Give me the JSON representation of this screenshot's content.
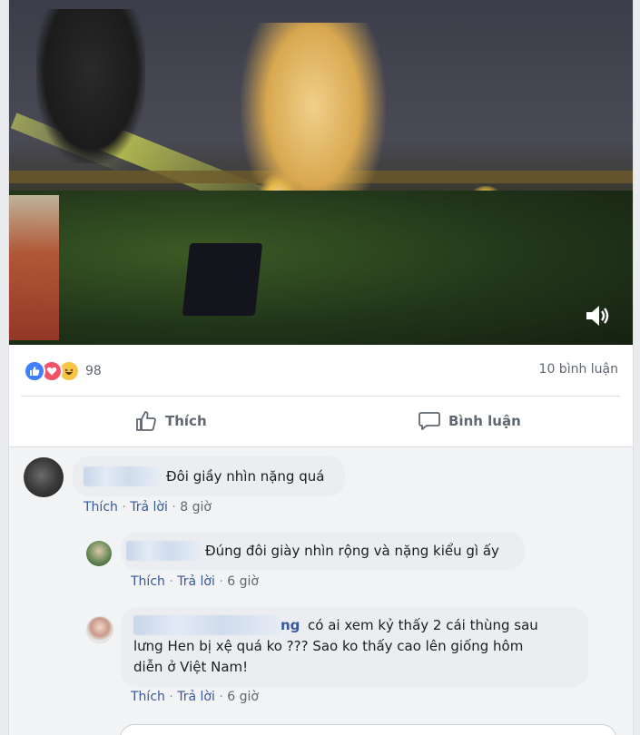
{
  "post": {
    "reaction_count": "98",
    "comment_count_text": "10 bình luận",
    "reactions": [
      "like-icon",
      "love-icon",
      "haha-icon"
    ]
  },
  "actions": {
    "like_label": "Thích",
    "comment_label": "Bình luận"
  },
  "comments": [
    {
      "name_visible": "",
      "text": "Đôi giầy nhìn nặng quá",
      "like_label": "Thích",
      "reply_label": "Trả lời",
      "time": "8 giờ"
    },
    {
      "name_visible": "",
      "text": "Đúng đôi giày nhìn rộng và nặng kiểu gì ấy",
      "like_label": "Thích",
      "reply_label": "Trả lời",
      "time": "6 giờ"
    },
    {
      "name_visible": "ng",
      "text_line1": "có ai xem kỷ thấy 2 cái thùng sau",
      "text_line2": "lưng Hen bị xệ quá ko ??? Sao ko thấy cao lên giống hôm",
      "text_line3": "diễn ở Việt Nam!",
      "like_label": "Thích",
      "reply_label": "Trả lời",
      "time": "6 giờ"
    }
  ],
  "colors": {
    "link": "#385898",
    "secondary_text": "#606770",
    "bubble": "#ebedf0",
    "like_blue": "#4080ff",
    "love_red": "#f25268",
    "haha_yellow": "#f7c444"
  }
}
